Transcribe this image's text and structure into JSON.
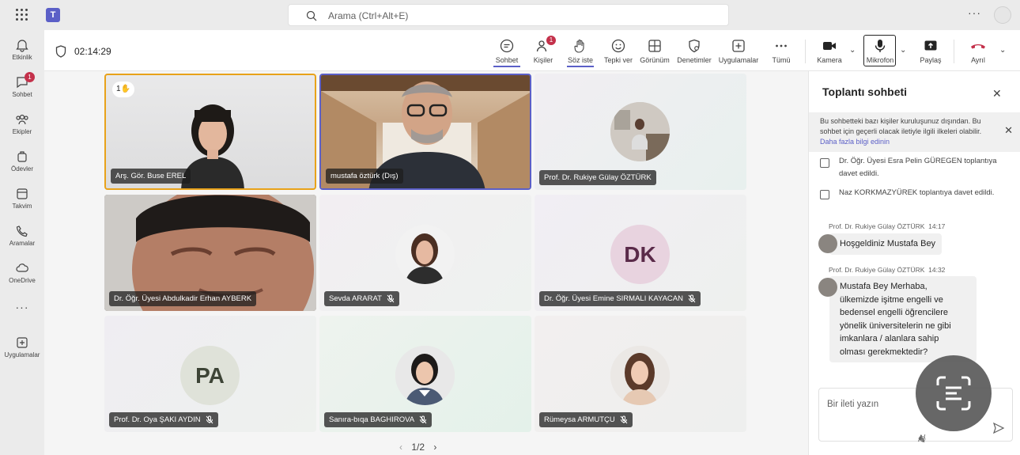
{
  "search": {
    "placeholder": "Arama (Ctrl+Alt+E)"
  },
  "rail": [
    {
      "label": "Etkinlik",
      "icon": "bell-icon"
    },
    {
      "label": "Sohbet",
      "icon": "chat-icon",
      "badge": "1"
    },
    {
      "label": "Ekipler",
      "icon": "teams-icon"
    },
    {
      "label": "Ödevler",
      "icon": "assignments-icon"
    },
    {
      "label": "Takvim",
      "icon": "calendar-icon"
    },
    {
      "label": "Aramalar",
      "icon": "phone-icon"
    },
    {
      "label": "OneDrive",
      "icon": "cloud-icon"
    },
    {
      "label": "Uygulamalar",
      "icon": "add-apps-icon"
    }
  ],
  "meeting": {
    "timer": "02:14:29",
    "toolbar": {
      "chat": "Sohbet",
      "people": "Kişiler",
      "people_badge": "1",
      "raise": "Söz iste",
      "react": "Tepki ver",
      "view": "Görünüm",
      "controls": "Denetimler",
      "apps": "Uygulamalar",
      "more": "Tümü",
      "camera": "Kamera",
      "mic": "Mikrofon",
      "share": "Paylaş",
      "leave": "Ayrıl"
    }
  },
  "participants": [
    {
      "name": "Arş. Gör. Buse EREL",
      "hand": "1"
    },
    {
      "name": "mustafa öztürk (Dış)"
    },
    {
      "name": "Prof. Dr. Rukiye Gülay ÖZTÜRK"
    },
    {
      "name": "Dr. Öğr. Üyesi Abdulkadir Erhan AYBERK"
    },
    {
      "name": "Sevda ARARAT"
    },
    {
      "name": "Dr. Öğr. Üyesi Emine SIRMALI KAYACAN",
      "initials": "DK"
    },
    {
      "name": "Prof. Dr. Oya ŞAKI AYDIN",
      "initials": "PA"
    },
    {
      "name": "Sanıra-bıqa BAGHIROVA"
    },
    {
      "name": "Rümeysa ARMUTÇU"
    }
  ],
  "pager": "1/2",
  "chat": {
    "title": "Toplantı sohbeti",
    "banner": "Bu sohbetteki bazı kişiler kuruluşunuz dışından. Bu sohbet için geçerli olacak iletiyle ilgili ilkeleri olabilir.",
    "banner_link": "Daha fazla bilgi edinin",
    "system": [
      "Dr. Öğr. Üyesi Esra Pelin GÜREGEN toplantıya davet edildi.",
      "Naz KORKMAZYÜREK toplantıya davet edildi."
    ],
    "messages": [
      {
        "sender": "Prof. Dr. Rukiye Gülay ÖZTÜRK",
        "time": "14:17",
        "text": "Hoşgeldiniz Mustafa Bey"
      },
      {
        "sender": "Prof. Dr. Rukiye Gülay ÖZTÜRK",
        "time": "14:32",
        "lines": [
          "Mustafa Bey Merhaba,",
          "ülkemizde işitme engelli ve",
          "bedensel engelli öğrencilere",
          "yönelik üniversitelerin ne gibi",
          "imkanlara / alanlara  sahip",
          "olması gerekmektedir?"
        ]
      }
    ],
    "compose_placeholder": "Bir ileti yazın"
  }
}
